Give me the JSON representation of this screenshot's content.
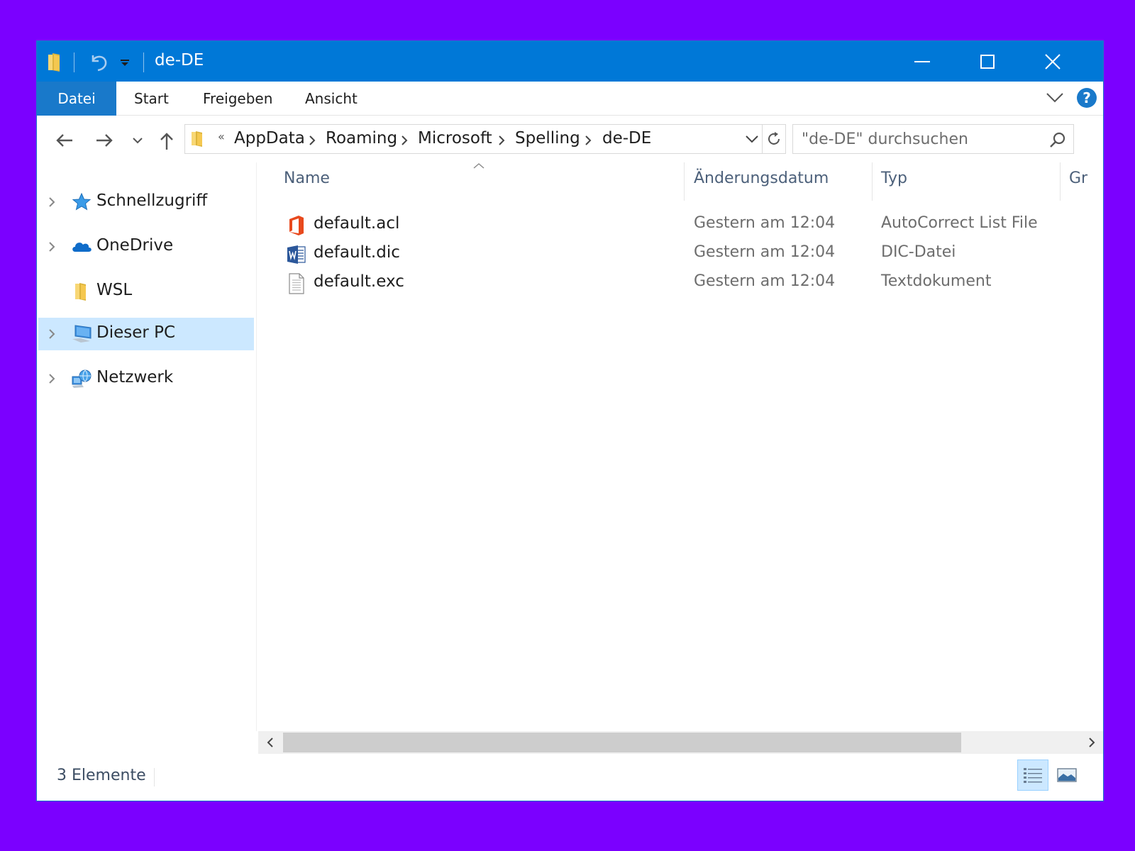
{
  "window": {
    "title": "de-DE",
    "accent": "#0078d7",
    "file_tab_color": "#1979ca",
    "background": "#7b00ff"
  },
  "titlebar": {
    "controls": [
      "minimize-icon",
      "maximize-icon",
      "close-icon"
    ],
    "quick_access": [
      "folder-icon",
      "undo-icon",
      "chevron-down-icon"
    ]
  },
  "ribbon": {
    "tabs": [
      "Datei",
      "Start",
      "Freigeben",
      "Ansicht"
    ],
    "help_label": "?"
  },
  "nav": {
    "overflow": "«",
    "breadcrumbs": [
      "AppData",
      "Roaming",
      "Microsoft",
      "Spelling",
      "de-DE"
    ],
    "search_placeholder": "\"de-DE\" durchsuchen"
  },
  "sidebar": {
    "items": [
      {
        "label": "Schnellzugriff",
        "icon": "star-icon",
        "expandable": true,
        "selected": false
      },
      {
        "label": "OneDrive",
        "icon": "cloud-icon",
        "expandable": true,
        "selected": false
      },
      {
        "label": "WSL",
        "icon": "folder-icon",
        "expandable": false,
        "selected": false
      },
      {
        "label": "Dieser PC",
        "icon": "computer-icon",
        "expandable": true,
        "selected": true
      },
      {
        "label": "Netzwerk",
        "icon": "network-icon",
        "expandable": true,
        "selected": false
      }
    ]
  },
  "table": {
    "columns": [
      "Name",
      "Änderungsdatum",
      "Typ",
      "Gr"
    ],
    "rows": [
      {
        "name": "default.acl",
        "date": "Gestern am 12:04",
        "type": "AutoCorrect List File",
        "icon": "office-icon"
      },
      {
        "name": "default.dic",
        "date": "Gestern am 12:04",
        "type": "DIC-Datei",
        "icon": "word-icon"
      },
      {
        "name": "default.exc",
        "date": "Gestern am 12:04",
        "type": "Textdokument",
        "icon": "text-document-icon"
      }
    ]
  },
  "scrollbar": {
    "thumb_start_fraction": 0.029,
    "thumb_end_fraction": 0.83
  },
  "status": {
    "count": "3 Elemente",
    "views": [
      "details-view-icon",
      "large-icons-view-icon"
    ],
    "active_view": "details-view-icon"
  }
}
